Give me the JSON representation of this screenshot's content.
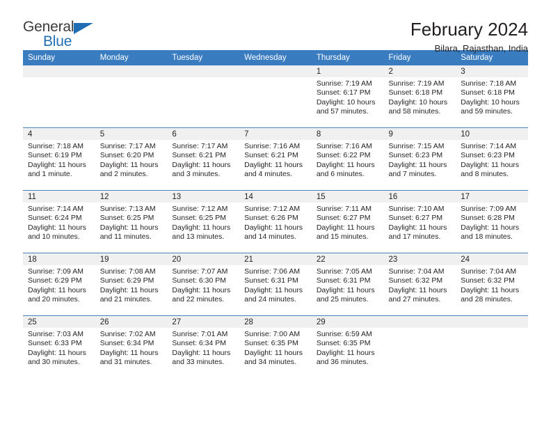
{
  "brand": {
    "name_top": "General",
    "name_bottom": "Blue",
    "triangle_color": "#1f6eb5"
  },
  "header": {
    "title": "February 2024",
    "subtitle": "Bilara, Rajasthan, India"
  },
  "theme": {
    "header_bg": "#3a7cc0",
    "row_divider": "#4a82b9",
    "daynum_bg": "#f0f0f0",
    "text": "#231f20"
  },
  "calendar": {
    "weekday_headers": [
      "Sunday",
      "Monday",
      "Tuesday",
      "Wednesday",
      "Thursday",
      "Friday",
      "Saturday"
    ],
    "weeks": [
      [
        {
          "empty": true
        },
        {
          "empty": true
        },
        {
          "empty": true
        },
        {
          "empty": true
        },
        {
          "day": "1",
          "sunrise": "Sunrise: 7:19 AM",
          "sunset": "Sunset: 6:17 PM",
          "daylight1": "Daylight: 10 hours",
          "daylight2": "and 57 minutes."
        },
        {
          "day": "2",
          "sunrise": "Sunrise: 7:19 AM",
          "sunset": "Sunset: 6:18 PM",
          "daylight1": "Daylight: 10 hours",
          "daylight2": "and 58 minutes."
        },
        {
          "day": "3",
          "sunrise": "Sunrise: 7:18 AM",
          "sunset": "Sunset: 6:18 PM",
          "daylight1": "Daylight: 10 hours",
          "daylight2": "and 59 minutes."
        }
      ],
      [
        {
          "day": "4",
          "sunrise": "Sunrise: 7:18 AM",
          "sunset": "Sunset: 6:19 PM",
          "daylight1": "Daylight: 11 hours",
          "daylight2": "and 1 minute."
        },
        {
          "day": "5",
          "sunrise": "Sunrise: 7:17 AM",
          "sunset": "Sunset: 6:20 PM",
          "daylight1": "Daylight: 11 hours",
          "daylight2": "and 2 minutes."
        },
        {
          "day": "6",
          "sunrise": "Sunrise: 7:17 AM",
          "sunset": "Sunset: 6:21 PM",
          "daylight1": "Daylight: 11 hours",
          "daylight2": "and 3 minutes."
        },
        {
          "day": "7",
          "sunrise": "Sunrise: 7:16 AM",
          "sunset": "Sunset: 6:21 PM",
          "daylight1": "Daylight: 11 hours",
          "daylight2": "and 4 minutes."
        },
        {
          "day": "8",
          "sunrise": "Sunrise: 7:16 AM",
          "sunset": "Sunset: 6:22 PM",
          "daylight1": "Daylight: 11 hours",
          "daylight2": "and 6 minutes."
        },
        {
          "day": "9",
          "sunrise": "Sunrise: 7:15 AM",
          "sunset": "Sunset: 6:23 PM",
          "daylight1": "Daylight: 11 hours",
          "daylight2": "and 7 minutes."
        },
        {
          "day": "10",
          "sunrise": "Sunrise: 7:14 AM",
          "sunset": "Sunset: 6:23 PM",
          "daylight1": "Daylight: 11 hours",
          "daylight2": "and 8 minutes."
        }
      ],
      [
        {
          "day": "11",
          "sunrise": "Sunrise: 7:14 AM",
          "sunset": "Sunset: 6:24 PM",
          "daylight1": "Daylight: 11 hours",
          "daylight2": "and 10 minutes."
        },
        {
          "day": "12",
          "sunrise": "Sunrise: 7:13 AM",
          "sunset": "Sunset: 6:25 PM",
          "daylight1": "Daylight: 11 hours",
          "daylight2": "and 11 minutes."
        },
        {
          "day": "13",
          "sunrise": "Sunrise: 7:12 AM",
          "sunset": "Sunset: 6:25 PM",
          "daylight1": "Daylight: 11 hours",
          "daylight2": "and 13 minutes."
        },
        {
          "day": "14",
          "sunrise": "Sunrise: 7:12 AM",
          "sunset": "Sunset: 6:26 PM",
          "daylight1": "Daylight: 11 hours",
          "daylight2": "and 14 minutes."
        },
        {
          "day": "15",
          "sunrise": "Sunrise: 7:11 AM",
          "sunset": "Sunset: 6:27 PM",
          "daylight1": "Daylight: 11 hours",
          "daylight2": "and 15 minutes."
        },
        {
          "day": "16",
          "sunrise": "Sunrise: 7:10 AM",
          "sunset": "Sunset: 6:27 PM",
          "daylight1": "Daylight: 11 hours",
          "daylight2": "and 17 minutes."
        },
        {
          "day": "17",
          "sunrise": "Sunrise: 7:09 AM",
          "sunset": "Sunset: 6:28 PM",
          "daylight1": "Daylight: 11 hours",
          "daylight2": "and 18 minutes."
        }
      ],
      [
        {
          "day": "18",
          "sunrise": "Sunrise: 7:09 AM",
          "sunset": "Sunset: 6:29 PM",
          "daylight1": "Daylight: 11 hours",
          "daylight2": "and 20 minutes."
        },
        {
          "day": "19",
          "sunrise": "Sunrise: 7:08 AM",
          "sunset": "Sunset: 6:29 PM",
          "daylight1": "Daylight: 11 hours",
          "daylight2": "and 21 minutes."
        },
        {
          "day": "20",
          "sunrise": "Sunrise: 7:07 AM",
          "sunset": "Sunset: 6:30 PM",
          "daylight1": "Daylight: 11 hours",
          "daylight2": "and 22 minutes."
        },
        {
          "day": "21",
          "sunrise": "Sunrise: 7:06 AM",
          "sunset": "Sunset: 6:31 PM",
          "daylight1": "Daylight: 11 hours",
          "daylight2": "and 24 minutes."
        },
        {
          "day": "22",
          "sunrise": "Sunrise: 7:05 AM",
          "sunset": "Sunset: 6:31 PM",
          "daylight1": "Daylight: 11 hours",
          "daylight2": "and 25 minutes."
        },
        {
          "day": "23",
          "sunrise": "Sunrise: 7:04 AM",
          "sunset": "Sunset: 6:32 PM",
          "daylight1": "Daylight: 11 hours",
          "daylight2": "and 27 minutes."
        },
        {
          "day": "24",
          "sunrise": "Sunrise: 7:04 AM",
          "sunset": "Sunset: 6:32 PM",
          "daylight1": "Daylight: 11 hours",
          "daylight2": "and 28 minutes."
        }
      ],
      [
        {
          "day": "25",
          "sunrise": "Sunrise: 7:03 AM",
          "sunset": "Sunset: 6:33 PM",
          "daylight1": "Daylight: 11 hours",
          "daylight2": "and 30 minutes."
        },
        {
          "day": "26",
          "sunrise": "Sunrise: 7:02 AM",
          "sunset": "Sunset: 6:34 PM",
          "daylight1": "Daylight: 11 hours",
          "daylight2": "and 31 minutes."
        },
        {
          "day": "27",
          "sunrise": "Sunrise: 7:01 AM",
          "sunset": "Sunset: 6:34 PM",
          "daylight1": "Daylight: 11 hours",
          "daylight2": "and 33 minutes."
        },
        {
          "day": "28",
          "sunrise": "Sunrise: 7:00 AM",
          "sunset": "Sunset: 6:35 PM",
          "daylight1": "Daylight: 11 hours",
          "daylight2": "and 34 minutes."
        },
        {
          "day": "29",
          "sunrise": "Sunrise: 6:59 AM",
          "sunset": "Sunset: 6:35 PM",
          "daylight1": "Daylight: 11 hours",
          "daylight2": "and 36 minutes."
        },
        {
          "empty": true
        },
        {
          "empty": true
        }
      ]
    ]
  }
}
